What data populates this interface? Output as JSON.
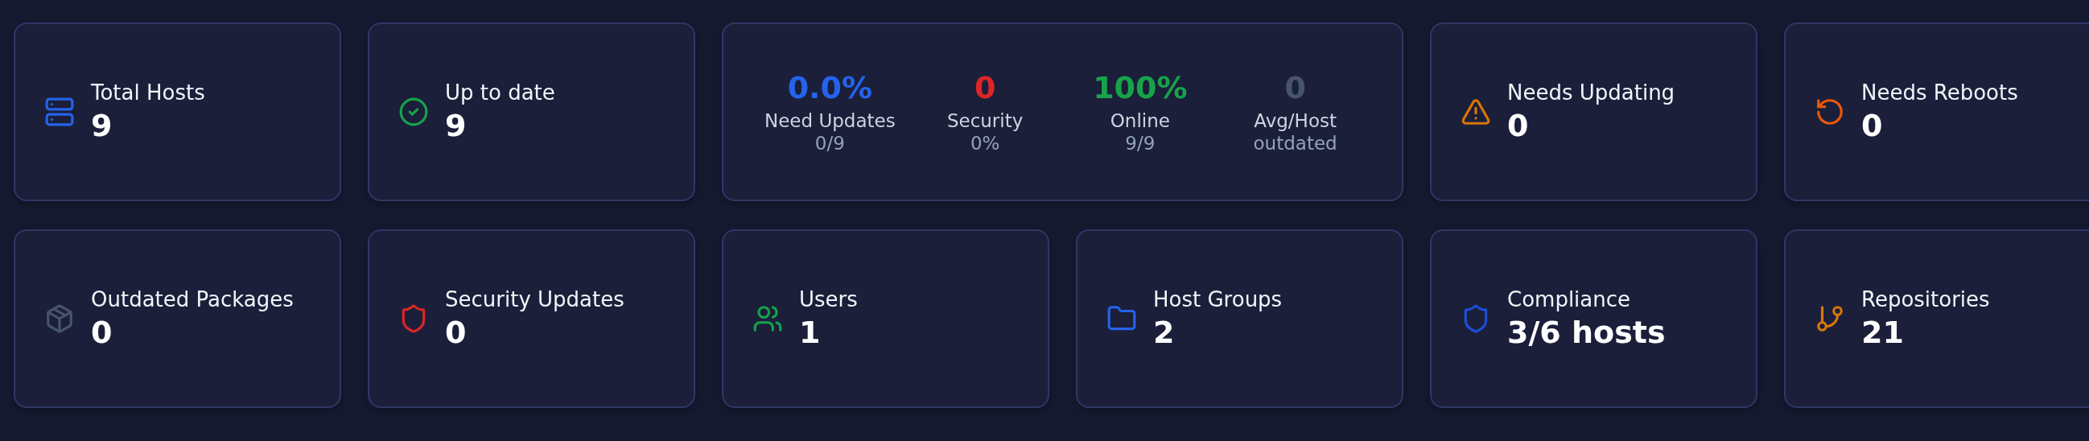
{
  "rows": [
    {
      "cards": [
        {
          "kind": "stat",
          "color": "#2563eb",
          "title": "Total Hosts",
          "value": "9"
        },
        {
          "kind": "stat",
          "color": "#16a34a",
          "title": "Up to date",
          "value": "9"
        },
        {
          "kind": "summary",
          "metrics": [
            {
              "value": "0.0%",
              "color": "#2563eb",
              "label": "Need Updates",
              "sub": "0/9"
            },
            {
              "value": "0",
              "color": "#dc2626",
              "label": "Security",
              "sub": "0%"
            },
            {
              "value": "100%",
              "color": "#16a34a",
              "label": "Online",
              "sub": "9/9"
            },
            {
              "value": "0",
              "color": "#475569",
              "label": "Avg/Host",
              "sub": "outdated"
            }
          ]
        },
        {
          "kind": "stat",
          "color": "#d97706",
          "title": "Needs Updating",
          "value": "0"
        },
        {
          "kind": "stat",
          "color": "#ea580c",
          "title": "Needs Reboots",
          "value": "0"
        }
      ]
    },
    {
      "cards": [
        {
          "kind": "stat",
          "color": "#475569",
          "title": "Outdated Packages",
          "value": "0"
        },
        {
          "kind": "stat",
          "color": "#dc2626",
          "title": "Security Updates",
          "value": "0"
        },
        {
          "kind": "stat",
          "color": "#16a34a",
          "title": "Users",
          "value": "1"
        },
        {
          "kind": "stat",
          "color": "#2563eb",
          "title": "Host Groups",
          "value": "2"
        },
        {
          "kind": "stat",
          "color": "#1d4ed8",
          "title": "Compliance",
          "value": "3/6 hosts"
        },
        {
          "kind": "stat",
          "color": "#d97706",
          "title": "Repositories",
          "value": "21"
        }
      ]
    }
  ]
}
